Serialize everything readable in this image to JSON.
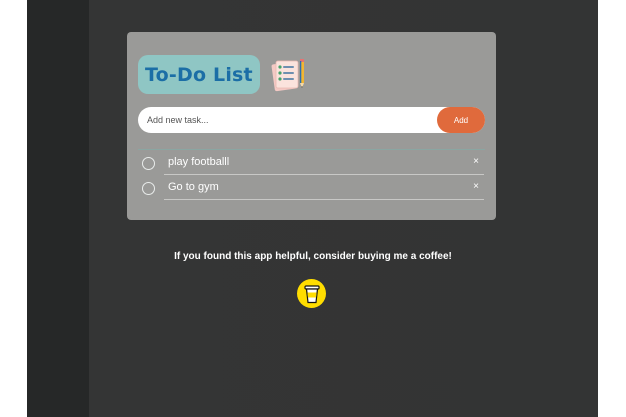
{
  "app": {
    "title": "To-Do List",
    "title_icon": "notepad-pencil-icon"
  },
  "input": {
    "placeholder": "Add new task...",
    "value": "",
    "add_label": "Add"
  },
  "tasks": [
    {
      "text": "play footballl",
      "completed": false
    },
    {
      "text": "Go to gym",
      "completed": false
    }
  ],
  "delete_glyph": "×",
  "footer": {
    "support_text": "If you found this app helpful, consider buying me a coffee!",
    "coffee_icon": "coffee-cup-icon"
  },
  "colors": {
    "background": "#2f3131",
    "card": "#9a9a98",
    "title_bg": "#8fc6c4",
    "title_text": "#1b6ea6",
    "add_button": "#e06a3c",
    "coffee_button": "#ffdd00"
  }
}
